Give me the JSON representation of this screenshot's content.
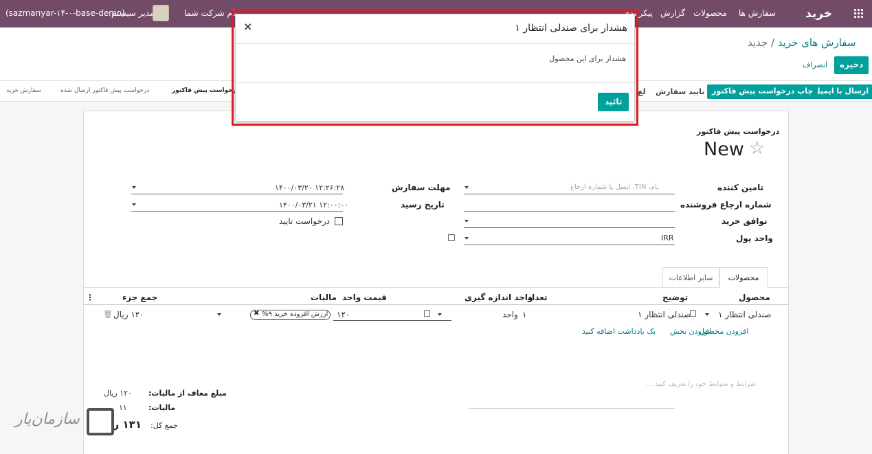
{
  "navbar": {
    "app_title": "خرید",
    "menu_orders": "سفارش ها",
    "menu_products": "محصولات",
    "menu_reporting": "گزارش",
    "menu_config": "پیکربندی",
    "company_name": "نام شرکت شما",
    "user_name": "مدیر سیستم",
    "db_name": "(sazmanyar-۱۴-۰-base-demo)"
  },
  "breadcrumb": {
    "parent": "سفارش های خرید",
    "separator": "/",
    "current": "جدید"
  },
  "actions": {
    "save": "ذخیره",
    "discard": "انصراف"
  },
  "statusbar": {
    "send_email": "ارسال با ایمیل",
    "print_rfq": "چاپ درخواست پیش فاکتور",
    "confirm_order": "تایید سفارش",
    "cancel_partial": "لغ",
    "stages": [
      "درخواست پیش فاکتور",
      "درخواست پیش فاکتور ارسال شده",
      "سفارش خرید"
    ]
  },
  "form": {
    "doc_type": "درخواست پیش فاکتور",
    "name": "New",
    "vendor_label": "تامین کننده",
    "vendor_placeholder": "نام، TIN، ایمیل یا شماره ارجاع",
    "vendor_ref_label": "شماره ارجاع فروشنده",
    "agreement_label": "توافق خرید",
    "currency_label": "واحد پول",
    "currency_value": "IRR",
    "deadline_label": "مهلت سفارش",
    "deadline_value": "۱۴۰۰/۰۳/۲۰ ۱۲:۲۶:۲۸",
    "receipt_label": "تاریخ رسید",
    "receipt_value": "۱۴۰۰/۰۳/۲۱ ۱۲:۰۰:۰۰",
    "ask_confirm_label": "درخواست تایید"
  },
  "tabs": {
    "products": "محصولات",
    "other_info": "سایر اطلاعات"
  },
  "table": {
    "headers": {
      "product": "محصول",
      "description": "توضیح",
      "qty": "تعداد",
      "uom": "واحد اندازه گیری",
      "unit_price": "قیمت واحد",
      "taxes": "مالیات",
      "subtotal": "جمع جزء"
    },
    "row": {
      "product": "صندلی انتظار ۱",
      "description": "صندلی انتظار ۱",
      "qty": "۱",
      "uom": "واحد",
      "unit_price": "۱۲۰",
      "tax_tag": "ارزش افزوده خرید ۹%",
      "subtotal": "۱۲۰ ریال"
    },
    "add_product": "افزودن محصول",
    "add_section": "افزودن بخش",
    "add_note": "یک یادداشت اضافه کنید"
  },
  "totals": {
    "terms_placeholder": "شرایط و ضوابط خود را تعریف کنید ...",
    "untaxed_label": "مبلغ معاف از مالیات:",
    "untaxed_value": "۱۲۰ ریال",
    "tax_label": "مالیات:",
    "tax_value": "۱۱",
    "total_label": "جمع کل:",
    "total_value": "۱۳۱ ریال"
  },
  "dialog": {
    "title": "هشدار برای صندلی انتظار ۱",
    "close": "×",
    "message": "هشدار برای این محصول",
    "ok": "تائید"
  },
  "watermark": "سازمان‌یار",
  "colors": {
    "navbar": "#714b67",
    "primary": "#00a09d",
    "link": "#017e84",
    "highlight": "#e01b24"
  }
}
